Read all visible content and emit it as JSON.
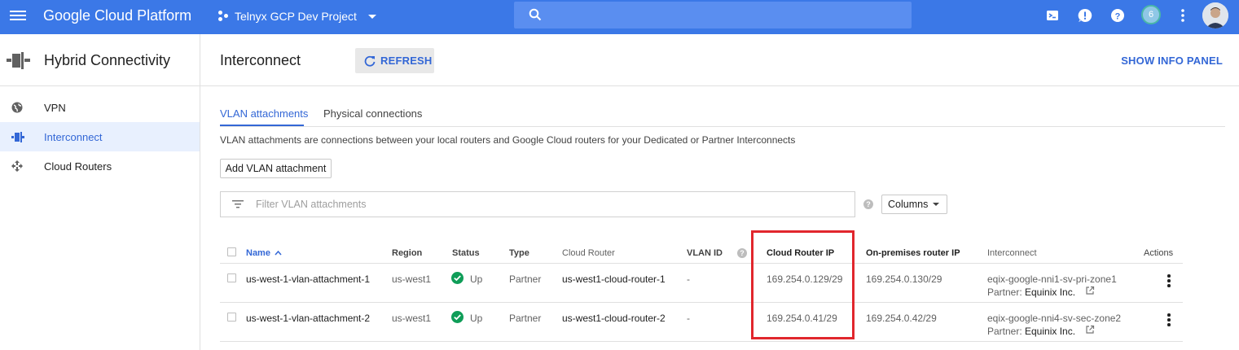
{
  "topbar": {
    "brand": "Google Cloud Platform",
    "project": "Telnyx GCP Dev Project",
    "notifications_count": "6",
    "icons": [
      "menu-icon",
      "search-icon",
      "cloud-shell-icon",
      "alert-icon",
      "help-icon",
      "account-avatar"
    ]
  },
  "sidebar": {
    "title": "Hybrid Connectivity",
    "items": [
      {
        "label": "VPN",
        "icon": "globe-icon"
      },
      {
        "label": "Interconnect",
        "icon": "interconnect-icon",
        "active": true
      },
      {
        "label": "Cloud Routers",
        "icon": "router-icon"
      }
    ]
  },
  "main": {
    "title": "Interconnect",
    "refresh_label": "REFRESH",
    "info_panel_label": "SHOW INFO PANEL",
    "tabs": [
      "VLAN attachments",
      "Physical connections"
    ],
    "description": "VLAN attachments are connections between your local routers and Google Cloud routers for your Dedicated or Partner Interconnects",
    "add_button": "Add VLAN attachment",
    "filter_placeholder": "Filter VLAN attachments",
    "help_glyph": "?",
    "columns_label": "Columns"
  },
  "table": {
    "headers": {
      "name": "Name",
      "region": "Region",
      "status": "Status",
      "type": "Type",
      "cloud_router": "Cloud Router",
      "vlan_id": "VLAN ID",
      "cloud_router_ip": "Cloud Router IP",
      "onprem_ip": "On-premises router IP",
      "interconnect": "Interconnect",
      "actions": "Actions"
    },
    "rows": [
      {
        "name": "us-west-1-vlan-attachment-1",
        "region": "us-west1",
        "status": "Up",
        "type": "Partner",
        "cloud_router": "us-west1-cloud-router-1",
        "vlan_id": "-",
        "cloud_router_ip": "169.254.0.129/29",
        "onprem_ip": "169.254.0.130/29",
        "interconnect": "eqix-google-nni1-sv-pri-zone1",
        "partner_prefix": "Partner:",
        "partner_name": "Equinix Inc."
      },
      {
        "name": "us-west-1-vlan-attachment-2",
        "region": "us-west1",
        "status": "Up",
        "type": "Partner",
        "cloud_router": "us-west1-cloud-router-2",
        "vlan_id": "-",
        "cloud_router_ip": "169.254.0.41/29",
        "onprem_ip": "169.254.0.42/29",
        "interconnect": "eqix-google-nni4-sv-sec-zone2",
        "partner_prefix": "Partner:",
        "partner_name": "Equinix Inc."
      }
    ]
  },
  "colors": {
    "topbar": "#3b78e7",
    "accent": "#3367d6",
    "status_up": "#0f9d58",
    "highlight_box": "#e1262d"
  }
}
